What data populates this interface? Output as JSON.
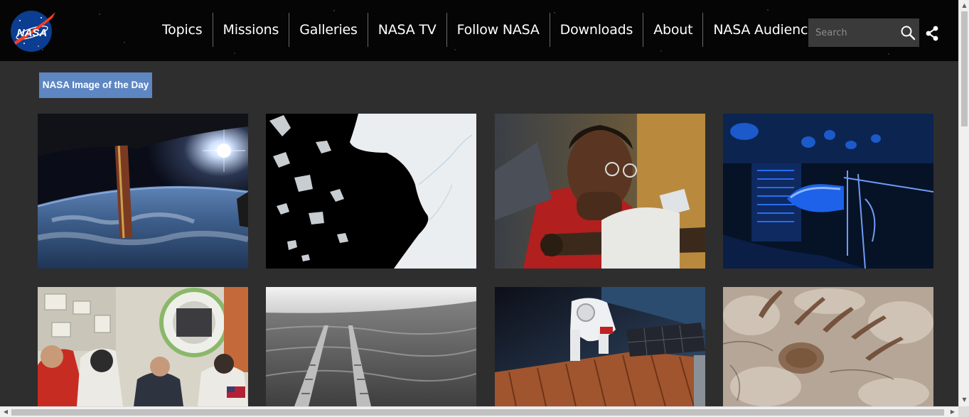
{
  "header": {
    "logo_text": "NASA",
    "nav": [
      "Topics",
      "Missions",
      "Galleries",
      "NASA TV",
      "Follow NASA",
      "Downloads",
      "About",
      "NASA Audiences"
    ],
    "search_placeholder": "Search",
    "icons": {
      "search": "search-icon",
      "share": "share-icon"
    }
  },
  "main": {
    "section_badge": "NASA Image of the Day",
    "gallery": [
      {
        "name": "earth-from-orbit-image"
      },
      {
        "name": "sea-ice-image"
      },
      {
        "name": "scientist-with-magnifier-image"
      },
      {
        "name": "blue-lab-equipment-image"
      },
      {
        "name": "astronauts-in-station-image"
      },
      {
        "name": "rover-tracks-image"
      },
      {
        "name": "spacewalk-image"
      },
      {
        "name": "mars-surface-image"
      }
    ]
  },
  "colors": {
    "page_background": "#2e2e2e",
    "header_background": "#050505",
    "badge_background": "#5d86c2"
  }
}
